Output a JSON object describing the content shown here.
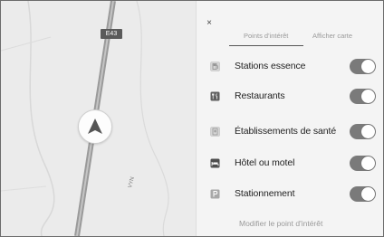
{
  "map": {
    "route_badge": "E43",
    "street_label": "VYN"
  },
  "panel": {
    "close_glyph": "×",
    "tabs": [
      {
        "label": "Points d'intérêt",
        "active": true
      },
      {
        "label": "Afficher carte",
        "active": false
      }
    ],
    "items": [
      {
        "label": "Stations essence",
        "icon": "fuel-icon",
        "enabled": true
      },
      {
        "label": "Restaurants",
        "icon": "restaurant-icon",
        "enabled": true
      },
      {
        "label": "Établissements de santé",
        "icon": "hospital-icon",
        "enabled": true
      },
      {
        "label": "Hôtel ou motel",
        "icon": "hotel-icon",
        "enabled": true
      },
      {
        "label": "Stationnement",
        "icon": "parking-icon",
        "enabled": true
      }
    ],
    "footer_link": "Modifier le point d'intérêt"
  },
  "colors": {
    "toggle_on": "#7a7a7a",
    "map_bg": "#ebebeb",
    "panel_bg": "#f4f4f4"
  }
}
